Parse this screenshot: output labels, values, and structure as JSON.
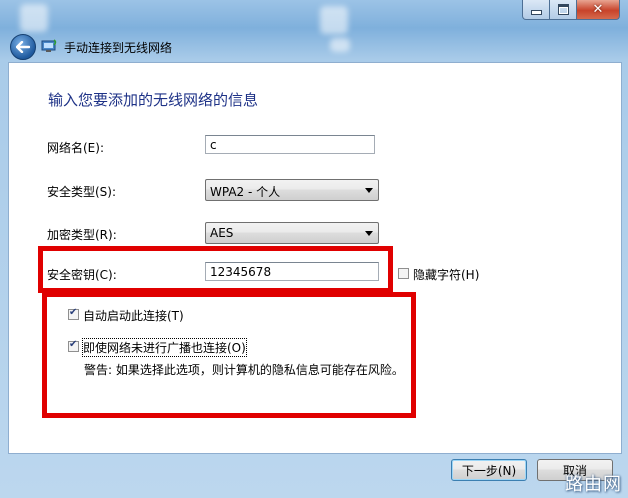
{
  "window": {
    "nav_title": "手动连接到无线网络"
  },
  "form": {
    "heading": "输入您要添加的无线网络的信息",
    "network_name_label": "网络名(E):",
    "network_name_value": "c",
    "security_type_label": "安全类型(S):",
    "security_type_value": "WPA2 - 个人",
    "encryption_type_label": "加密类型(R):",
    "encryption_type_value": "AES",
    "security_key_label": "安全密钥(C):",
    "security_key_value": "12345678",
    "hide_chars_label": "隐藏字符(H)",
    "hide_chars_checked": false,
    "auto_start_label": "自动启动此连接(T)",
    "auto_start_checked": true,
    "connect_hidden_label": "即使网络未进行广播也连接(O)",
    "connect_hidden_checked": true,
    "warning_text": "警告: 如果选择此选项，则计算机的隐私信息可能存在风险。"
  },
  "buttons": {
    "next_label": "下一步(N)",
    "cancel_label": "取消"
  },
  "watermark": "路由网",
  "colors": {
    "heading": "#1e3287",
    "highlight_box": "#e00000"
  }
}
